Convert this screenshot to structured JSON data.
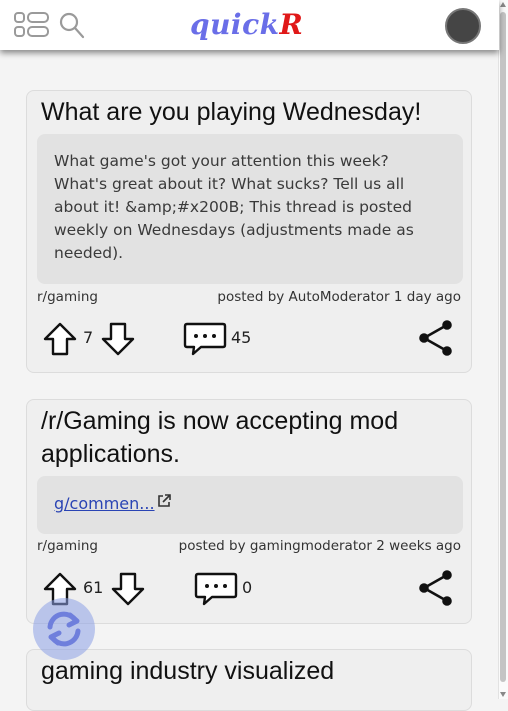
{
  "app": {
    "logo_main": "quick",
    "logo_accent": "R"
  },
  "header": {
    "menu_icon": "grid-menu-icon",
    "search_icon": "search-icon",
    "avatar": "avatar"
  },
  "posts": [
    {
      "title": "What are you playing Wednesday!",
      "body": "What game's got your attention this week? What's great about it? What sucks? Tell us all about it! &amp;#x200B; This thread is posted weekly on Wednesdays (adjustments made as needed).",
      "subreddit": "r/gaming",
      "posted": "posted by AutoModerator 1 day ago",
      "votes": "7",
      "comments": "45"
    },
    {
      "title": "/r/Gaming is now accepting mod applications.",
      "link": "g/commen...",
      "subreddit": "r/gaming",
      "posted": "posted by gamingmoderator 2 weeks ago",
      "votes": "61",
      "comments": "0"
    },
    {
      "title": "gaming industry visualized"
    }
  ],
  "colors": {
    "logo_main": "#6a6ee8",
    "logo_accent": "#e01818",
    "card_bg": "#efefef",
    "body_bg": "#e2e2e2",
    "link": "#2a44b4"
  }
}
